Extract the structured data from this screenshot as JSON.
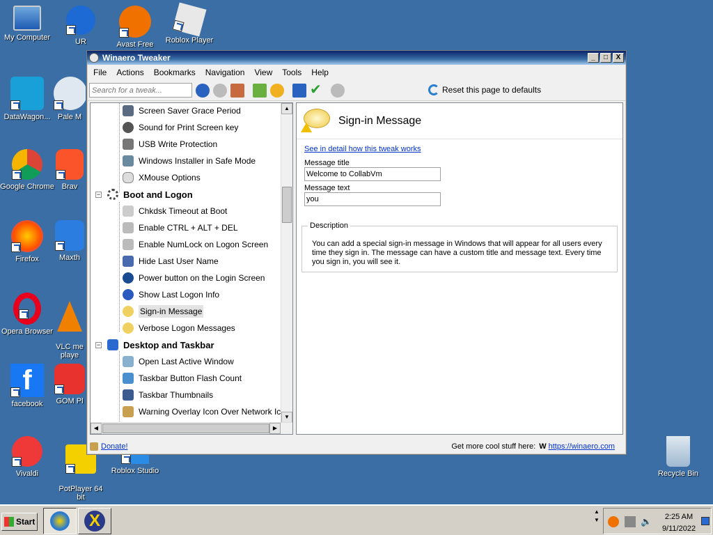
{
  "desktop": {
    "icons": [
      {
        "label": "My Computer"
      },
      {
        "label": "UR"
      },
      {
        "label": "Avast Free"
      },
      {
        "label": "Roblox Player"
      },
      {
        "label": "DataWagon..."
      },
      {
        "label": "Pale M"
      },
      {
        "label": "Google Chrome"
      },
      {
        "label": "Brav"
      },
      {
        "label": "Firefox"
      },
      {
        "label": "Maxth"
      },
      {
        "label": "Opera Browser"
      },
      {
        "label": "VLC me\nplaye"
      },
      {
        "label": "facebook"
      },
      {
        "label": "GOM Pl"
      },
      {
        "label": "Vivaldi"
      },
      {
        "label": "PotPlayer 64\nbit"
      },
      {
        "label": "Roblox Studio"
      },
      {
        "label": "Recycle Bin"
      }
    ]
  },
  "window": {
    "title": "Winaero Tweaker",
    "controls": {
      "minimize": "_",
      "maximize": "□",
      "close": "X"
    },
    "menu": [
      "File",
      "Actions",
      "Bookmarks",
      "Navigation",
      "View",
      "Tools",
      "Help"
    ],
    "search_placeholder": "Search for a tweak...",
    "reset_label": "Reset this page to defaults"
  },
  "tree": {
    "items": [
      {
        "label": "Screen Saver Grace Period",
        "type": "item",
        "icon": "screensaver-icon"
      },
      {
        "label": "Sound for Print Screen key",
        "type": "item",
        "icon": "sound-icon"
      },
      {
        "label": "USB Write Protection",
        "type": "item",
        "icon": "usb-icon"
      },
      {
        "label": "Windows Installer in Safe Mode",
        "type": "item",
        "icon": "installer-icon"
      },
      {
        "label": "XMouse Options",
        "type": "item",
        "icon": "mouse-icon"
      },
      {
        "label": "Boot and Logon",
        "type": "category",
        "icon": "boot-spinner-icon"
      },
      {
        "label": "Chkdsk Timeout at Boot",
        "type": "item",
        "icon": "disk-icon"
      },
      {
        "label": "Enable CTRL + ALT + DEL",
        "type": "item",
        "icon": "keyboard-icon"
      },
      {
        "label": "Enable NumLock on Logon Screen",
        "type": "item",
        "icon": "keyboard-icon"
      },
      {
        "label": "Hide Last User Name",
        "type": "item",
        "icon": "user-icon"
      },
      {
        "label": "Power button on the Login Screen",
        "type": "item",
        "icon": "power-icon"
      },
      {
        "label": "Show Last Logon Info",
        "type": "item",
        "icon": "help-icon"
      },
      {
        "label": "Sign-in Message",
        "type": "item",
        "icon": "message-icon",
        "selected": true
      },
      {
        "label": "Verbose Logon Messages",
        "type": "item",
        "icon": "message-icon"
      },
      {
        "label": "Desktop and Taskbar",
        "type": "category",
        "icon": "desktop-icon"
      },
      {
        "label": "Open Last Active Window",
        "type": "item",
        "icon": "window-icon"
      },
      {
        "label": "Taskbar Button Flash Count",
        "type": "item",
        "icon": "taskbar-icon"
      },
      {
        "label": "Taskbar Thumbnails",
        "type": "item",
        "icon": "thumbnail-icon"
      },
      {
        "label": "Warning Overlay Icon Over Network Icon in",
        "type": "item",
        "icon": "warning-icon"
      }
    ]
  },
  "detail": {
    "title": "Sign-in Message",
    "link": "See in detail how this tweak works",
    "message_title_label": "Message title",
    "message_title_value": "Welcome to CollabVm",
    "message_text_label": "Message text",
    "message_text_value": "you",
    "description_legend": "Description",
    "description_text": "You can add a special sign-in message in Windows that will appear for all users every time they sign in. The message can have a custom title and message text. Every time you sign in, you will see it."
  },
  "status": {
    "donate": "Donate!",
    "promo": "Get more cool stuff here:",
    "url": "https://winaero.com"
  },
  "taskbar": {
    "start": "Start",
    "time": "2:25 AM",
    "date": "9/11/2022"
  },
  "colors": {
    "desktop": "#3a6ea5",
    "titlebar": "#0a246a",
    "link": "#0033cc"
  }
}
